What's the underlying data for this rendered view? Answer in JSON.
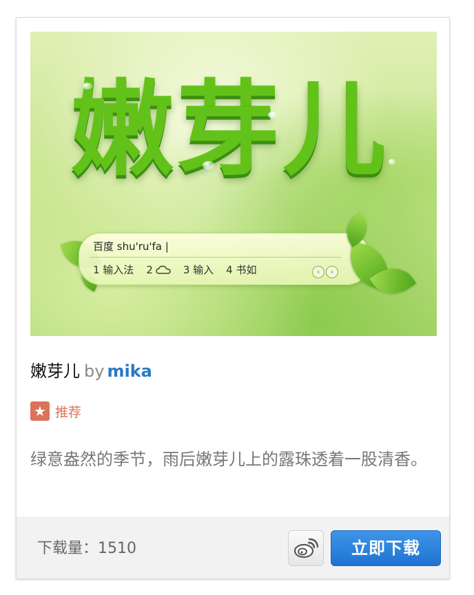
{
  "skin": {
    "preview_title": "嫩芽儿",
    "ime": {
      "input_text": "百度 shu'ru'fa |",
      "candidates": [
        "1 输入法",
        "2",
        "3 输入",
        "4 书如"
      ],
      "nav_prev": "‹",
      "nav_next": "›"
    },
    "name": "嫩芽儿",
    "by_label": "by",
    "author": "mika",
    "badge_label": "推荐",
    "badge_icon": "star-icon",
    "description": "绿意盎然的季节，雨后嫩芽儿上的露珠透着一股清香。"
  },
  "footer": {
    "download_count": "下载量：1510",
    "share_icon": "weibo-icon",
    "download_label": "立即下载"
  },
  "colors": {
    "author_link": "#2979c6",
    "badge": "#d9735a",
    "download_button": "#1f73d2",
    "preview_text": "#63c21a"
  }
}
